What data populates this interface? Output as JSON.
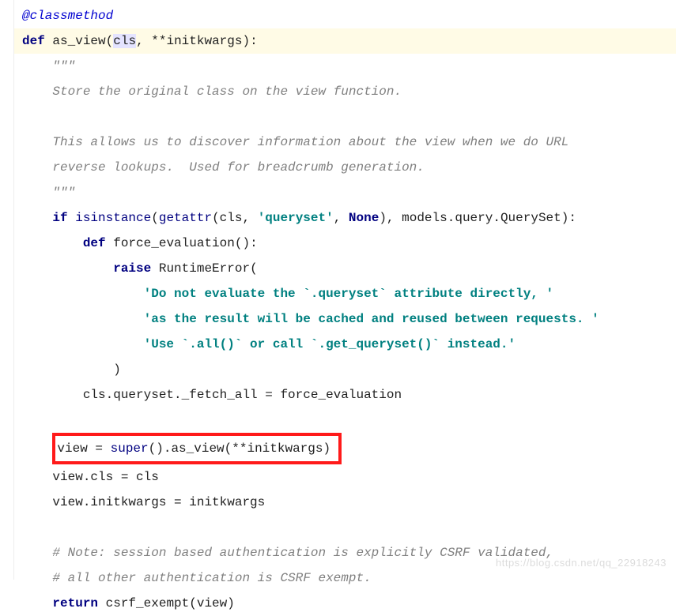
{
  "code": {
    "decorator": "@classmethod",
    "def_kw": "def",
    "func_name": "as_view",
    "param_cls": "cls",
    "param_rest": ", **initkwargs):",
    "doc_open": "\"\"\"",
    "doc1": "Store the original class on the view function.",
    "doc2": "This allows us to discover information about the view when we do URL",
    "doc3": "reverse lookups.  Used for breadcrumb generation.",
    "doc_close": "\"\"\"",
    "if_kw": "if",
    "isinstance_fn": "isinstance",
    "getattr_fn": "getattr",
    "cls_ref": "cls",
    "queryset_str": "'queryset'",
    "none_lit": "None",
    "models_path": "models.query.QuerySet",
    "def_kw2": "def",
    "force_eval": "force_evaluation",
    "raise_kw": "raise",
    "runtime_error": "RuntimeError",
    "err_l1": "'Do not evaluate the `.queryset` attribute directly, '",
    "err_l2": "'as the result will be cached and reused between requests. '",
    "err_l3": "'Use `.all()` or call `.get_queryset()` instead.'",
    "close_paren": ")",
    "assign_fetch": "cls.queryset._fetch_all = force_evaluation",
    "view_assign_lhs": "view = ",
    "super_fn": "super",
    "as_view_call": ".as_view(**initkwargs)",
    "view_cls_line": "view.cls = cls",
    "view_cls_rhs": "cls",
    "view_init_line": "view.initkwargs = initkwargs",
    "comment1": "# Note: session based authentication is explicitly CSRF validated,",
    "comment2": "# all other authentication is CSRF exempt.",
    "return_kw": "return",
    "csrf_call": "csrf_exempt(view)"
  },
  "watermark": "https://blog.csdn.net/qq_22918243"
}
